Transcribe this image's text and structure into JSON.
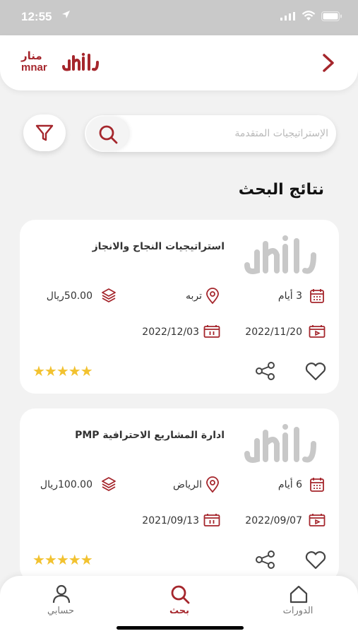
{
  "status_bar": {
    "time": "12:55"
  },
  "header": {
    "logo_ar": "منار",
    "logo_en": "mnar",
    "back_icon": "chevron-right-icon"
  },
  "search": {
    "placeholder": "الإستراتيجيات المتقدمة",
    "search_icon": "search-icon",
    "filter_icon": "filter-icon"
  },
  "section_title": "نتائج البحث",
  "courses": [
    {
      "title": "استراتيجيات النجاح والانجاز",
      "duration": "3 أيام",
      "location": "تربه",
      "price": "50.00ريال",
      "start_date": "2022/11/20",
      "end_date": "2022/12/03",
      "rating": "★★★★★"
    },
    {
      "title": "ادارة المشاريع الاحترافية PMP",
      "duration": "6 أيام",
      "location": "الرياض",
      "price": "100.00ريال",
      "start_date": "2022/09/07",
      "end_date": "2021/09/13",
      "rating": "★★★★★"
    }
  ],
  "tabbar": {
    "courses": "الدورات",
    "search": "بحث",
    "account": "حسابي"
  },
  "colors": {
    "brand": "#a5262c",
    "star": "#f2c230"
  }
}
